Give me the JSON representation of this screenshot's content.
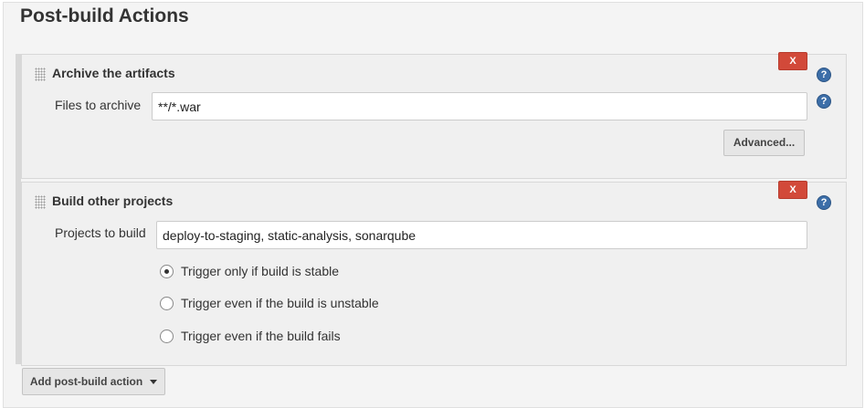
{
  "section_title": "Post-build Actions",
  "archive": {
    "title": "Archive the artifacts",
    "delete_label": "X",
    "help_label": "?",
    "files_label": "Files to archive",
    "files_value": "**/*.war",
    "field_help_label": "?",
    "advanced_label": "Advanced..."
  },
  "build_other": {
    "title": "Build other projects",
    "delete_label": "X",
    "help_label": "?",
    "projects_label": "Projects to build",
    "projects_value": "deploy-to-staging, static-analysis, sonarqube",
    "trigger_options": [
      {
        "label": "Trigger only if build is stable",
        "checked": true
      },
      {
        "label": "Trigger even if the build is unstable",
        "checked": false
      },
      {
        "label": "Trigger even if the build fails",
        "checked": false
      }
    ]
  },
  "add_action_label": "Add post-build action",
  "colors": {
    "delete": "#d24939",
    "help": "#3c6ea8"
  }
}
